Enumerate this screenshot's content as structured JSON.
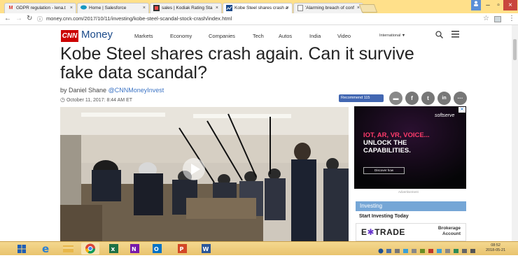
{
  "browser": {
    "tabs": [
      {
        "icon": "gmail-icon",
        "label": "GDPR regulation - lena.t",
        "active": false
      },
      {
        "icon": "salesforce-icon",
        "label": "Home | Salesforce",
        "active": false
      },
      {
        "icon": "kodiak-icon",
        "label": "sales | Kodiak Rating Sta",
        "active": false
      },
      {
        "icon": "cnn-money-icon",
        "label": "Kobe Steel shares crash a",
        "active": true
      },
      {
        "icon": "page-icon",
        "label": "'Alarming breach of conf",
        "active": false
      }
    ],
    "tab_close": "×",
    "url": "money.cnn.com/2017/10/11/investing/kobe-steel-scandal-stock-crash/index.html",
    "info_icon": "ⓘ"
  },
  "site": {
    "logo": "CNN",
    "brand": "Money",
    "nav": [
      "Markets",
      "Economy",
      "Companies",
      "Tech",
      "Autos",
      "India",
      "Video"
    ],
    "edition": "International ▼"
  },
  "article": {
    "headline": "Kobe Steel shares crash again. Can it survive fake data scandal?",
    "byline_prefix": "by Daniel Shane",
    "byline_handle": "@CNNMoneyInvest",
    "date": "October 11, 2017: 8:44 AM ET",
    "recommend": "Recommend 115"
  },
  "ad": {
    "brand": "softserve",
    "line1": "IOT, AR, VR, VOICE...",
    "line2": "UNLOCK THE",
    "line3": "CAPABILITIES.",
    "button": "Discover how",
    "label": "Advertisement"
  },
  "sidebar": {
    "section": "Investing",
    "subhead": "Start Investing Today",
    "advertiser_e": "E",
    "advertiser_rest": "TRADE",
    "advertiser_tag": "Brokerage Account"
  },
  "taskbar": {
    "time": "08:52",
    "date": "2018-05-21",
    "apps": [
      "windows-start-icon",
      "ie-icon",
      "file-explorer-icon",
      "chrome-icon",
      "excel-icon",
      "onenote-icon",
      "outlook-icon",
      "powerpoint-icon",
      "word-icon"
    ]
  },
  "colors": {
    "cnn_red": "#cc0000",
    "link_blue": "#3b73c4",
    "taskbar": "#f0cf7f",
    "investing_bar": "#75a6d6"
  }
}
